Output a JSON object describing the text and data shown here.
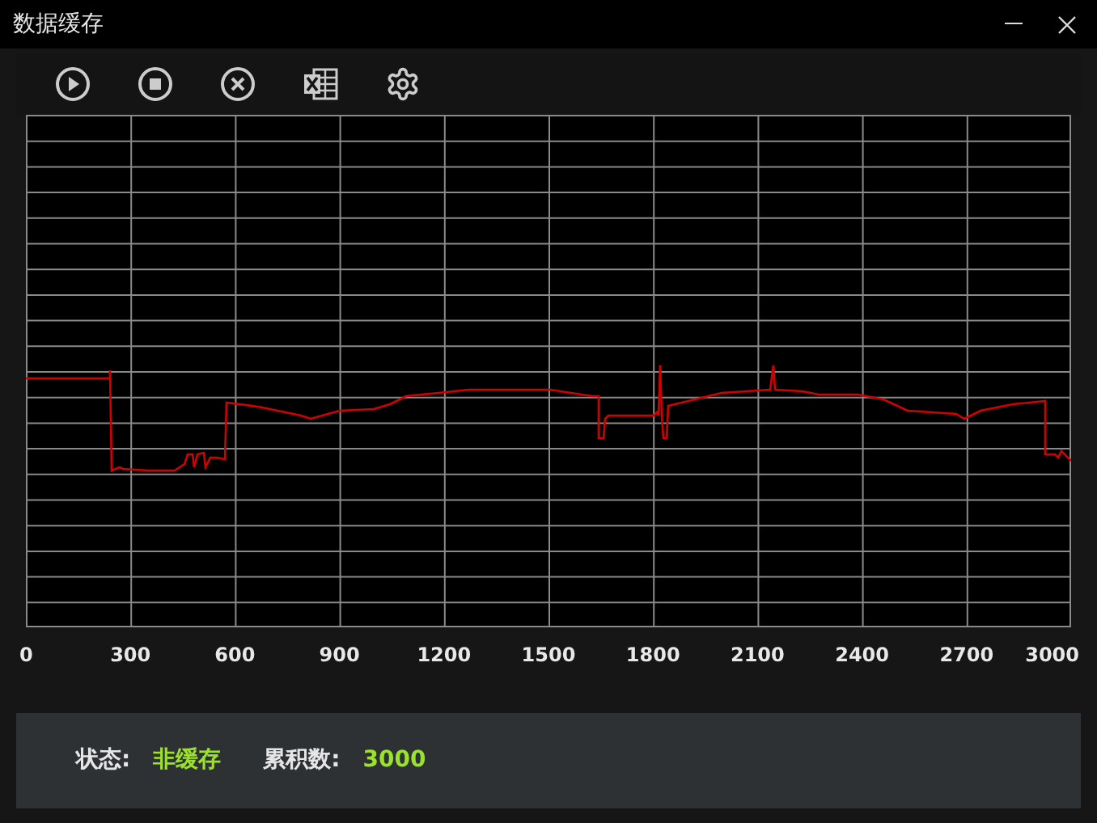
{
  "window": {
    "title": "数据缓存"
  },
  "chart": {
    "x_axis_labels": [
      "0",
      "300",
      "600",
      "900",
      "1200",
      "1500",
      "1800",
      "2100",
      "2400",
      "2700",
      "3000"
    ]
  },
  "status_panel": {
    "fields": [
      {
        "label": "状态:",
        "value": "非缓存"
      },
      {
        "label": "累积数:",
        "value": "3000"
      }
    ]
  }
}
